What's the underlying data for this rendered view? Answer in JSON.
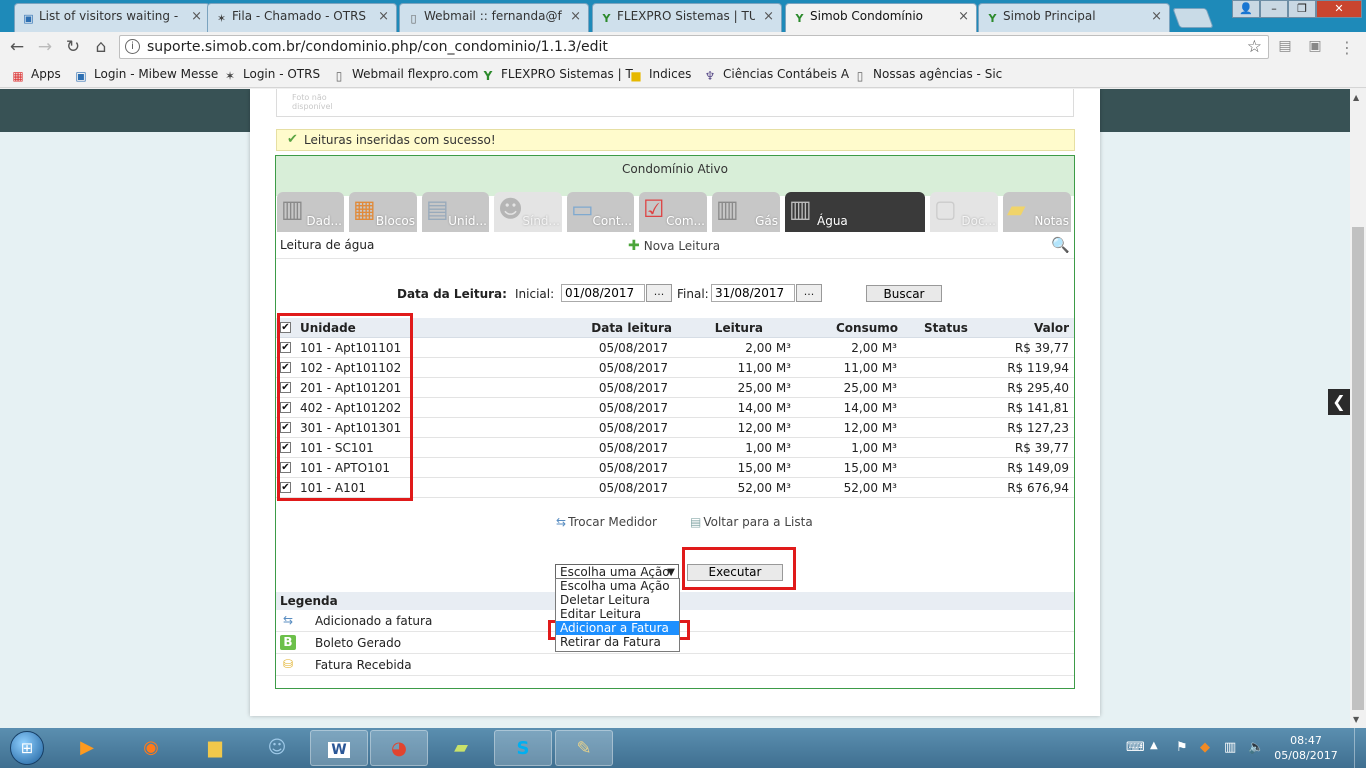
{
  "browser": {
    "tabs": [
      {
        "title": "List of visitors waiting - M",
        "icon": "chat-icon"
      },
      {
        "title": "Fila - Chamado - OTRS",
        "icon": "otrs-icon"
      },
      {
        "title": "Webmail :: fernanda@fle",
        "icon": "page-icon"
      },
      {
        "title": "FLEXPRO Sistemas | TUN",
        "icon": "flexpro-icon"
      },
      {
        "title": "Simob Condomínio",
        "icon": "simob-icon",
        "active": true
      },
      {
        "title": "Simob Principal",
        "icon": "simob-icon"
      }
    ],
    "url": "suporte.simob.com.br/condominio.php/con_condominio/1.1.3/edit",
    "bookmarks": [
      {
        "label": "Apps",
        "icon": "apps-grid-icon"
      },
      {
        "label": "Login - Mibew Messe",
        "icon": "chat-icon"
      },
      {
        "label": "Login - OTRS",
        "icon": "otrs-icon"
      },
      {
        "label": "Webmail flexpro.com",
        "icon": "page-icon"
      },
      {
        "label": "FLEXPRO Sistemas | T",
        "icon": "flexpro-icon"
      },
      {
        "label": "Indices",
        "icon": "folder-icon"
      },
      {
        "label": "Ciências Contábeis A",
        "icon": "emblem-icon"
      },
      {
        "label": "Nossas agências - Sic",
        "icon": "page-icon"
      }
    ]
  },
  "page": {
    "photo_placeholder": "Foto não disponível",
    "success_message": "Leituras inseridas com sucesso!",
    "panel_title": "Condomínio Ativo",
    "tabs": [
      {
        "label": "Dad..."
      },
      {
        "label": "Blocos"
      },
      {
        "label": "Unid..."
      },
      {
        "label": "Sínd..."
      },
      {
        "label": "Cont..."
      },
      {
        "label": "Com..."
      },
      {
        "label": "Gás"
      },
      {
        "label": "Água",
        "active": true
      },
      {
        "label": "Doc..."
      },
      {
        "label": "Notas"
      }
    ],
    "section_title": "Leitura de água",
    "new_reading": "Nova Leitura",
    "filter": {
      "label": "Data da Leitura:",
      "start_label": "Inicial:",
      "start_value": "01/08/2017",
      "end_label": "Final:",
      "end_value": "31/08/2017",
      "picker": "...",
      "search_button": "Buscar"
    },
    "table": {
      "headers": {
        "unit": "Unidade",
        "date": "Data leitura",
        "reading": "Leitura",
        "consumption": "Consumo",
        "status": "Status",
        "value": "Valor"
      },
      "rows": [
        {
          "unit": "101 - Apt101101",
          "date": "05/08/2017",
          "reading": "2,00 M³",
          "consumption": "2,00 M³",
          "status": "",
          "value": "R$ 39,77"
        },
        {
          "unit": "102 - Apt101102",
          "date": "05/08/2017",
          "reading": "11,00 M³",
          "consumption": "11,00 M³",
          "status": "",
          "value": "R$ 119,94"
        },
        {
          "unit": "201 - Apt101201",
          "date": "05/08/2017",
          "reading": "25,00 M³",
          "consumption": "25,00 M³",
          "status": "",
          "value": "R$ 295,40"
        },
        {
          "unit": "402 - Apt101202",
          "date": "05/08/2017",
          "reading": "14,00 M³",
          "consumption": "14,00 M³",
          "status": "",
          "value": "R$ 141,81"
        },
        {
          "unit": "301 - Apt101301",
          "date": "05/08/2017",
          "reading": "12,00 M³",
          "consumption": "12,00 M³",
          "status": "",
          "value": "R$ 127,23"
        },
        {
          "unit": "101 - SC101",
          "date": "05/08/2017",
          "reading": "1,00 M³",
          "consumption": "1,00 M³",
          "status": "",
          "value": "R$ 39,77"
        },
        {
          "unit": "101 - APTO101",
          "date": "05/08/2017",
          "reading": "15,00 M³",
          "consumption": "15,00 M³",
          "status": "",
          "value": "R$ 149,09"
        },
        {
          "unit": "101 - A101",
          "date": "05/08/2017",
          "reading": "52,00 M³",
          "consumption": "52,00 M³",
          "status": "",
          "value": "R$ 676,94"
        }
      ]
    },
    "links": {
      "swap_meter": "Trocar Medidor",
      "back_to_list": "Voltar para a Lista"
    },
    "action": {
      "selected": "Escolha uma Ação",
      "execute_button": "Executar",
      "options": [
        "Escolha uma Ação",
        "Deletar Leitura",
        "Editar Leitura",
        "Adicionar a Fatura",
        "Retirar da Fatura"
      ],
      "highlighted": "Adicionar a Fatura"
    },
    "legend": {
      "title": "Legenda",
      "items": [
        {
          "label": "Adicionado a fatura",
          "icon": "invoice-added-icon"
        },
        {
          "label": "Boleto Gerado",
          "icon": "boleto-icon"
        },
        {
          "label": "Fatura Recebida",
          "icon": "coins-icon"
        }
      ]
    }
  },
  "taskbar": {
    "time": "08:47",
    "date": "05/08/2017"
  }
}
